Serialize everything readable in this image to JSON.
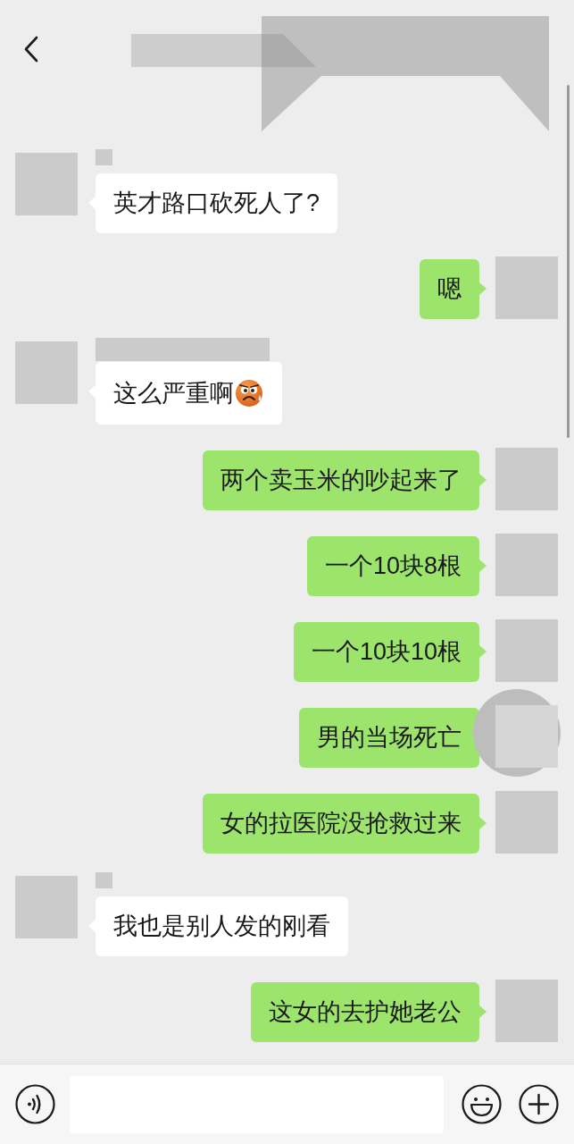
{
  "messages": [
    {
      "kind": "received",
      "name_mask": {
        "kind": "short"
      },
      "text": "英才路口砍死人了?"
    },
    {
      "kind": "sent",
      "text": "嗯"
    },
    {
      "kind": "received",
      "name_mask": {
        "kind": "long"
      },
      "text": "这么严重啊",
      "emoji": true
    },
    {
      "kind": "sent",
      "text": "两个卖玉米的吵起来了"
    },
    {
      "kind": "sent",
      "text": "一个10块8根"
    },
    {
      "kind": "sent",
      "text": "一个10块10根"
    },
    {
      "kind": "sent",
      "text": "男的当场死亡",
      "avatar_masked": true
    },
    {
      "kind": "sent",
      "text": "女的拉医院没抢救过来"
    },
    {
      "kind": "received",
      "name_mask": {
        "kind": "short"
      },
      "text": "我也是别人发的刚看"
    },
    {
      "kind": "sent",
      "text": "这女的去护她老公"
    }
  ]
}
